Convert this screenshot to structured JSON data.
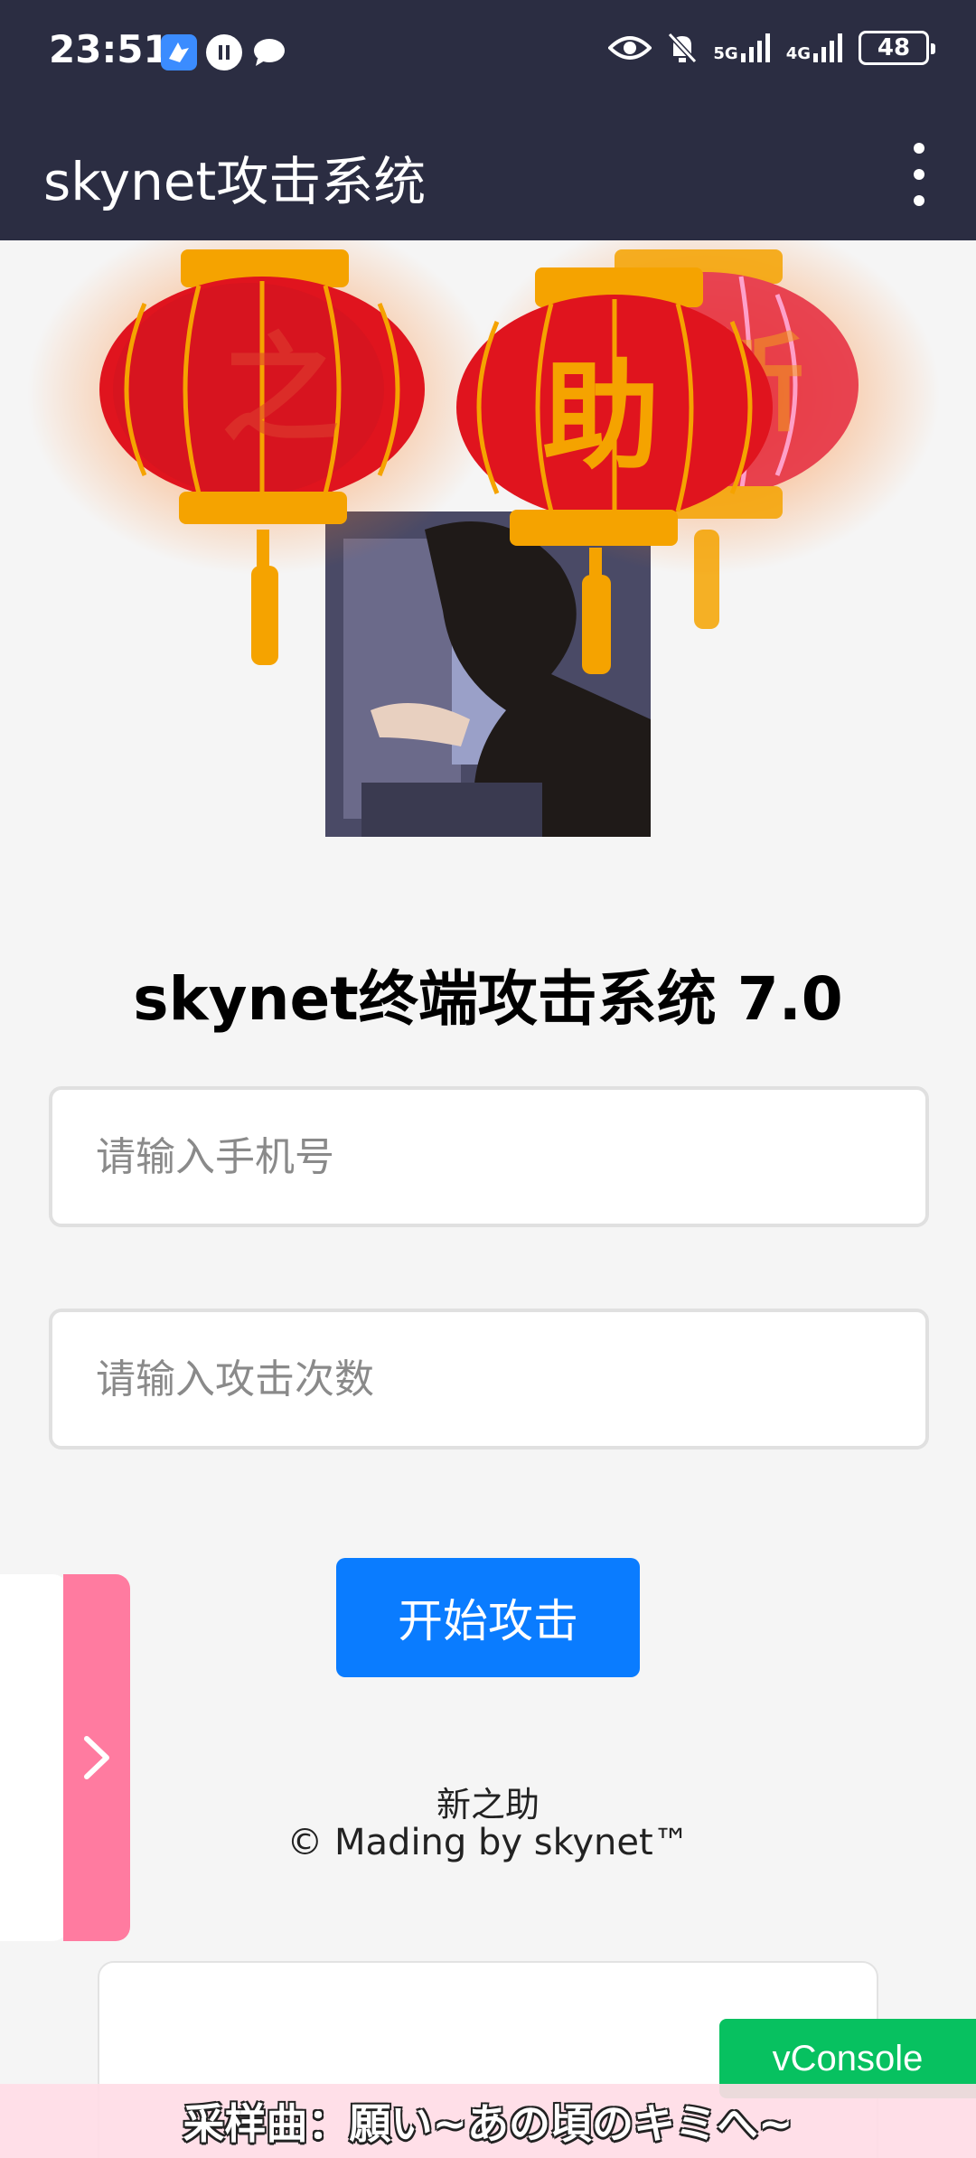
{
  "status_bar": {
    "time": "23:51",
    "network_1": "5G",
    "network_2": "4G",
    "battery": "48",
    "icons_left": [
      "app-notification-icon",
      "sync-icon",
      "chat-icon"
    ],
    "icons_right": [
      "eye-icon",
      "bell-muted-icon",
      "signal-5g-icon",
      "signal-4g-icon",
      "battery-icon"
    ]
  },
  "app_bar": {
    "title": "skynet攻击系统",
    "menu_icon": "more-vertical-icon"
  },
  "banner": {
    "lantern_left_char": "之",
    "lantern_center_char": "助",
    "lantern_right_char": "新"
  },
  "main": {
    "headline": "skynet终端攻击系统 7.0",
    "phone_placeholder": "请输入手机号",
    "count_placeholder": "请输入攻击次数",
    "attack_button": "开始攻击",
    "footer_line1": "新之助",
    "footer_line2": "© Mading by skynet™"
  },
  "side_tab": {
    "icon": "chevron-right-icon"
  },
  "vconsole": {
    "label": "vConsole"
  },
  "music": {
    "text": "采样曲：願い~あの頃のキミへ~"
  },
  "colors": {
    "app_bar": "#2b2d42",
    "primary_button": "#0a7cff",
    "side_tab": "#ff7ba0",
    "vconsole": "#07c160",
    "lantern_red": "#e0141e",
    "lantern_gold": "#f5a300"
  }
}
